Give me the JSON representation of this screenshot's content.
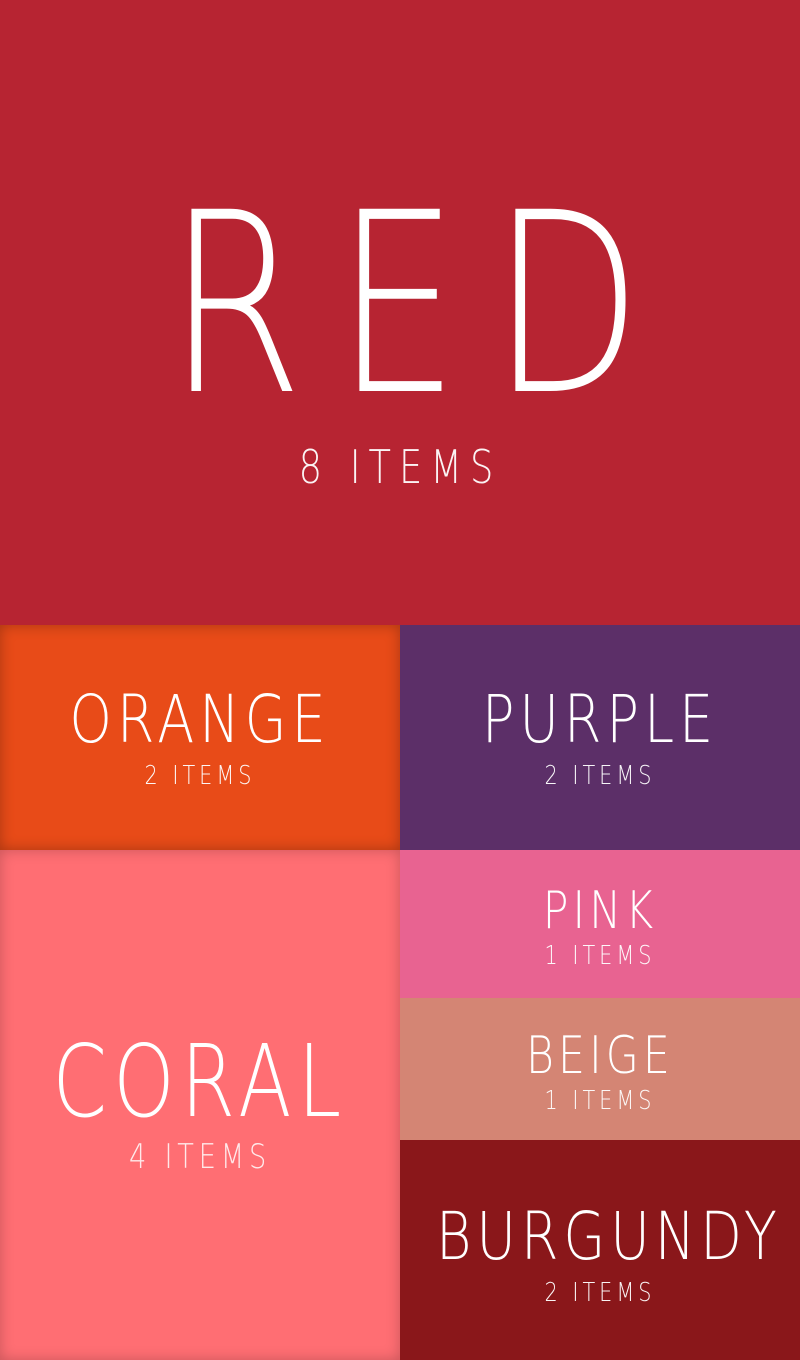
{
  "categories": [
    {
      "key": "red",
      "name": "RED",
      "count": "8 ITEMS",
      "color": "#B72432"
    },
    {
      "key": "orange",
      "name": "ORANGE",
      "count": "2 ITEMS",
      "color": "#E84B18"
    },
    {
      "key": "purple",
      "name": "PURPLE",
      "count": "2 ITEMS",
      "color": "#5C2F68"
    },
    {
      "key": "coral",
      "name": "CORAL",
      "count": "4 ITEMS",
      "color": "#FF6E73"
    },
    {
      "key": "pink",
      "name": "PINK",
      "count": "1 ITEMS",
      "color": "#E86391"
    },
    {
      "key": "beige",
      "name": "BEIGE",
      "count": "1 ITEMS",
      "color": "#D48574"
    },
    {
      "key": "burgundy",
      "name": "BURGUNDY",
      "count": "2 ITEMS",
      "color": "#8A171A"
    }
  ]
}
